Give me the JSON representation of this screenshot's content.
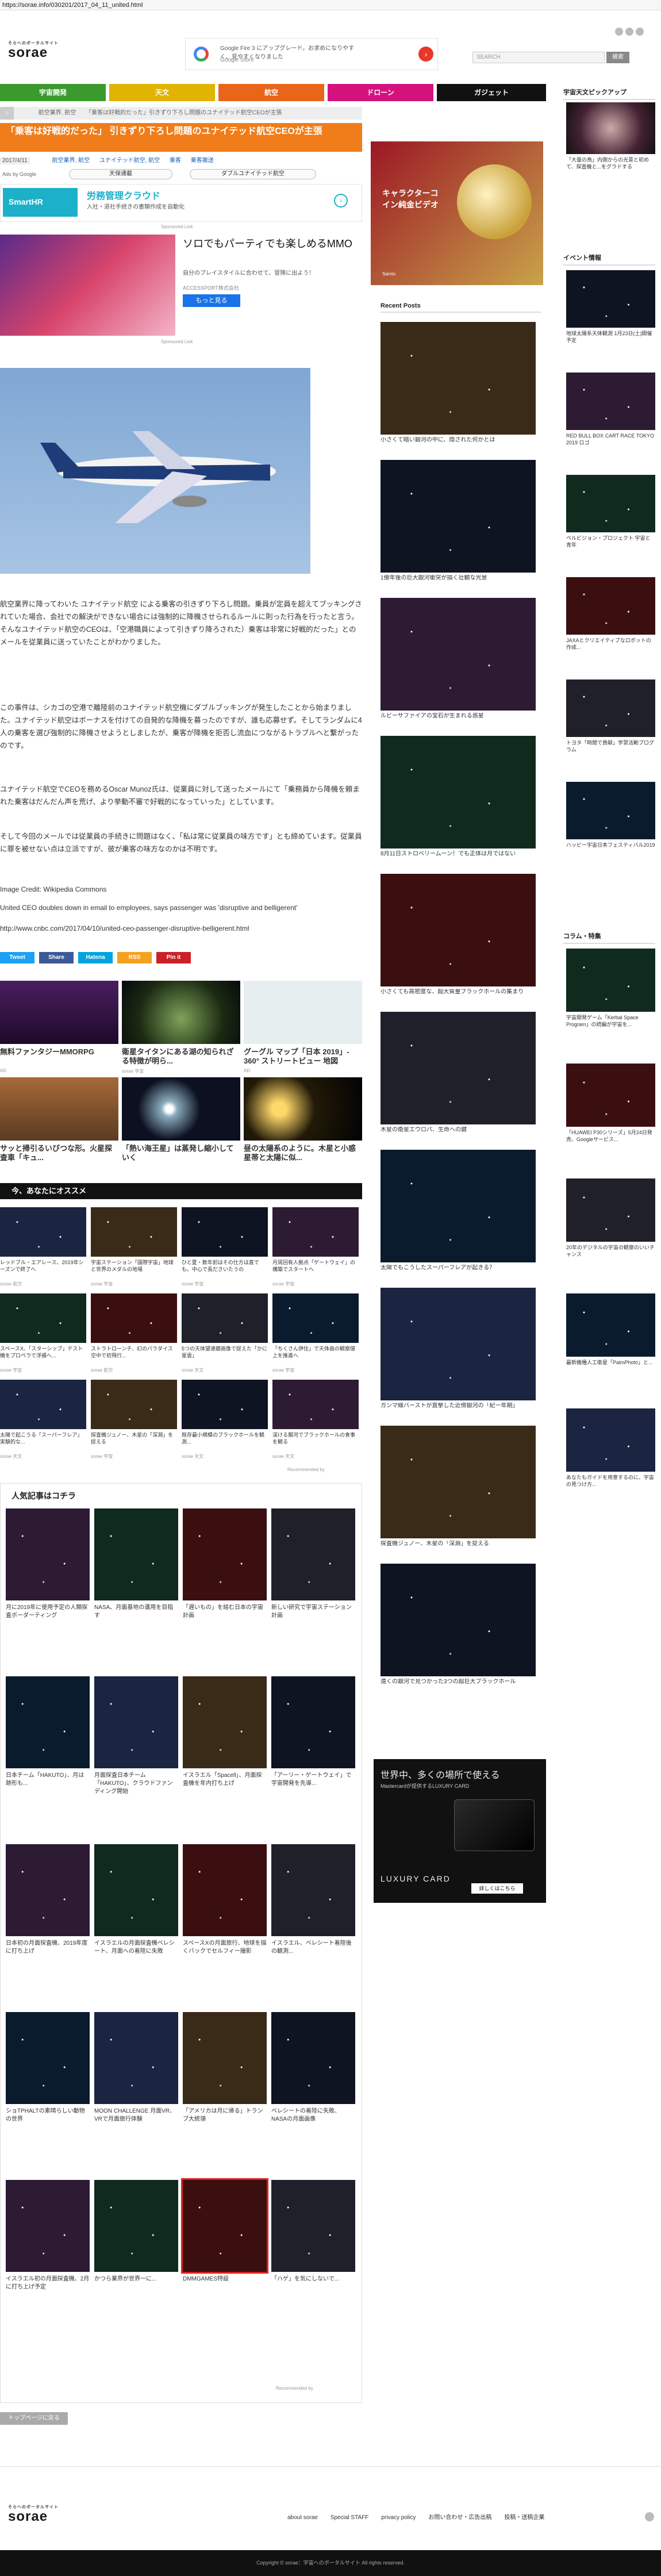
{
  "browser": {
    "url": "https://sorae.info/030201/2017_04_11_united.html"
  },
  "header": {
    "logo_small": "そらへのポータルサイト",
    "logo": "sorae",
    "search_placeholder": "SEARCH",
    "search_button": "検索"
  },
  "top_ad": {
    "text1": "Google Fire 3 にアップグレード。お求めになりやすく、見やすくなりました",
    "text2": "Google Store"
  },
  "nav": {
    "items": [
      {
        "label": "宇宙開発",
        "color": "#3a9a2e"
      },
      {
        "label": "天文",
        "color": "#e0b400"
      },
      {
        "label": "航空",
        "color": "#e8651a"
      },
      {
        "label": "ドローン",
        "color": "#d4127e"
      },
      {
        "label": "ガジェット",
        "color": "#111111"
      }
    ]
  },
  "breadcrumb": {
    "home": "⌂",
    "items": [
      "航空業界, 航空",
      "「乗客は好戦的だった」引きずり下ろし問題のユナイテッド航空CEOが主張"
    ]
  },
  "article": {
    "title": "「乗客は好戦的だった」 引きずり下ろし問題のユナイテッド航空CEOが主張",
    "date": "2017/4/11",
    "meta_tags": [
      "航空業界, 航空",
      "ユナイテッド航空, 航空",
      "乗客",
      "乗客搬送"
    ],
    "ads_by": "Ads by Google",
    "tag_buttons": [
      "天保通載",
      "ダブルユナイテッド航空"
    ],
    "smarthr_ad": {
      "title": "労務管理クラウド",
      "name": "SmartHR",
      "sub": "入社・退社手続きの書類作成を自動化",
      "note": "Sponsored Link"
    },
    "game_ad": {
      "heading": "ソロでもパーティでも楽しめるMMO",
      "line1": "自分のプレイスタイルに合わせて、冒険に出よう！",
      "company": "ACCESSPORT株式会社",
      "button": "もっと見る",
      "note": "Sponsored Link"
    },
    "paragraphs": [
      "航空業界に降ってわいた ユナイテッド航空 による乗客の引きずり下ろし問題。乗員が定員を超えてブッキングされていた場合、会社での解決ができない場合には強制的に降機させられるルールに則った行為を行ったと言う。そんなユナイテッド航空のCEOは、「空港職員によって引きずり降ろされた）乗客は非常に好戦的だった」とのメールを従業員に送っていたことがわかりました。",
      "この事件は、シカゴの空港で離陸前のユナイテッド航空機にダブルブッキングが発生したことから始まりました。ユナイテッド航空はボーナスを付けての自発的な降機を募ったのですが、誰も応募せず。そしてランダムに4人の乗客を選び強制的に降機させようとしましたが、乗客が降機を拒否し流血につながるトラブルへと繋がったのです。",
      "ユナイテッド航空でCEOを務めるOscar Munoz氏は、従業員に対して送ったメールにて「乗務員から降機を頼まれた乗客はだんだん声を荒げ、より挙動不審で好戦的になっていった」としています。",
      "そして今回のメールでは従業員の手続きに問題はなく、「私は常に従業員の味方です」とも締めています。従業員に罪を被せない点は立派ですが、彼が乗客の味方なのかは不明です。"
    ],
    "credit": "Image Credit: Wikipedia Commons",
    "source_title": "United CEO doubles down in email to employees, says passenger was 'disruptive and belligerent'",
    "source_url": "http://www.cnbc.com/2017/04/10/united-ceo-passenger-disruptive-belligerent.html",
    "share": [
      {
        "label": "Tweet",
        "color": "#1da1f2"
      },
      {
        "label": "Share",
        "color": "#3b5998"
      },
      {
        "label": "Hatena",
        "color": "#00a4de"
      },
      {
        "label": "RSS",
        "color": "#f4a122"
      },
      {
        "label": "Pin it",
        "color": "#cb2027"
      }
    ]
  },
  "promo_top": [
    {
      "title": "無料ファンタジーMMORPG",
      "src": "AD"
    },
    {
      "title": "衛星タイタンにある湖の知られざる特徴が明ら...",
      "src": "sorae 宇宙"
    },
    {
      "title": "グーグル マップ「日本 2019」- 360° ストリートビュー 地図",
      "src": "AD"
    },
    {
      "title": "サッと掃引るいびつな形。火星探査車「キュ...",
      "src": "sorae 宇宙"
    },
    {
      "title": "「熱い海王星」は蒸発し縮小していく",
      "src": "sorae 宇宙"
    },
    {
      "title": "昼の太陽系のように。木星と小惑星帯と太陽に似...",
      "src": "sorae 宇宙"
    }
  ],
  "recommend": {
    "heading": "今、あなたにオススメ",
    "items": [
      {
        "t": "レッドブル・エアレース、2019年シーズンで終了へ",
        "s": "sorae 航空"
      },
      {
        "t": "宇宙ステーション「国際宇宙」地球と世界のメダルの地場",
        "s": "sorae 宇宙"
      },
      {
        "t": "ひと夏・数年前はその仕方は直でも。中心で長ださいたうの",
        "s": "sorae 宇宙"
      },
      {
        "t": "月周回有人拠点「ゲートウェイ」の構築でスタートへ",
        "s": "sorae 宇宙"
      },
      {
        "t": "スペースX、「スターシップ」テスト機をプロペラで浮揚へ...",
        "s": "sorae 宇宙"
      },
      {
        "t": "ストラトローンチ、幻のパラダイス空中で初飛行...",
        "s": "sorae 航空"
      },
      {
        "t": "5つの天体望遠鏡画像で捉えた「かに星雲」",
        "s": "sorae 天文"
      },
      {
        "t": "「ちくさん伊住」で天体画の観察値上を推進へ",
        "s": "sorae 宇宙"
      },
      {
        "t": "太陽で起こうる「スーパーフレア」実験的な...",
        "s": "sorae 天文"
      },
      {
        "t": "探査機ジュノー、木星の「深淵」を捉える",
        "s": "sorae 宇宙"
      },
      {
        "t": "既存最小規模のブラックホールを観測...",
        "s": "sorae 天文"
      },
      {
        "t": "渓ける銀河でブラックホールの食事を観る",
        "s": "sorae 天文"
      }
    ],
    "note": "Recommended by"
  },
  "popular": {
    "heading": "人気記事はコチラ",
    "items": [
      "月に2019年に使用予定の人類探査ボーダーティング",
      "NASA、月面基地の運用を目指す",
      "「遅いもの」を組む日本の宇宙計画",
      "新しい研究で宇宙ステーション計画",
      "日本チーム「HAKUTO」、月は跡形も...",
      "月面探査日本チーム「HAKUTO」、クラウドファンディング開始",
      "イスラエル「Spacell」、月面探査機を年内打ち上げ",
      "「アーリー・ゲートウェイ」で宇宙開発を先導...",
      "日本初の月面探査機、2019年度に打ち上げ",
      "イスラエルの月面探査機ベレシート、月面への着陸に失敗",
      "スペースXの月面旅行、地球を描くバックでセルフィー撮影",
      "イスラエル、ベレシート着陸後の観測...",
      "ショTPHALTの素晴らしい動物の世界",
      "MOON CHALLENGE 月面VR、VRで月面旅行体験",
      "「アメリカは月に帰る」トランプ大統領",
      "ベレシートの着陸に失敗、NASAの月面画像",
      "イスラエル初の月面探査機、2月に打ち上げ予定",
      "かつら業界が世界一に...",
      "DMMGAMES特設",
      "「ハゲ」を気にしないで..."
    ],
    "note": "Recommended by"
  },
  "back_button": "トップページに戻る",
  "right_ad": {
    "title": "キャラクターコイン純金ビデオ",
    "note": "Sanrio"
  },
  "recent": {
    "heading": "Recent Posts",
    "items": [
      "小さくて暗い銀河の中に、隠された何かとは",
      "1億年後の巨大銀河衝突が描く壮観な光景",
      "ルビーサファイアの宝石が生まれる惑星",
      "8月11日ストロベリームーン！でも正体は月ではない",
      "小さくても高密度な、超大質量ブラックホールの集まり",
      "木星の衛星エウロパ、生命への鍵",
      "太陽でもこうしたスーパーフレアが起きる？",
      "ガンマ線バーストが直撃した近傍銀河の「紀ー年期」",
      "探査機ジュノー、木星の「深淵」を捉える",
      "遠くの銀河で見つかった3つの超巨大ブラックホール"
    ]
  },
  "card_ad": {
    "line1": "世界中、多くの場所で使える",
    "line2": "Mastercardが提供するLUXURY CARD",
    "brand": "LUXURY CARD",
    "btn": "詳しくはこちら"
  },
  "pickup": {
    "heading": "宇宙天文ピックアップ",
    "item": "「大量の鳥」内側からの光景と初めて、探査機と...をグラドする"
  },
  "events": {
    "heading": "イベント情報",
    "items": [
      "地球太陽系天体観測 1月23日(土)開催予定",
      "RED BULL BOX CART RACE TOKYO 2019 ロゴ",
      "ベルビジョン・プロジェクト 宇宙と青年",
      "JAXAとクリエイティブなロボットの作成...",
      "トヨタ「時間で貢献」学習活動プログラム",
      "ハッピー宇宙日本フェスティバル2019"
    ]
  },
  "column": {
    "heading": "コラム・特集",
    "items": [
      "宇宙開発ゲーム「Kerbal Space Program」の続編が宇宙を...",
      "「HUAWEI P30シリーズ」5月24日発売、Googleサービス...",
      "20年のデジタルの宇宙の観察のいいチャンス",
      "最新機種人工衛星「PalmPhoto」と...",
      "あなたもガイドを用意するのに、宇宙の見つけ方..."
    ]
  },
  "footer": {
    "logo": "sorae",
    "logo_small": "そらへのポータルサイト",
    "links": [
      "about sorae",
      "Special STAFF",
      "privacy policy",
      "お問い合わせ・広告出稿",
      "投稿・送稿企業"
    ],
    "copyright": "Copyright © sorae：宇宙へのポータルサイト All rights reserved."
  },
  "colors": {
    "orange": "#f08a1e",
    "title_bar": "#f07d1a"
  }
}
